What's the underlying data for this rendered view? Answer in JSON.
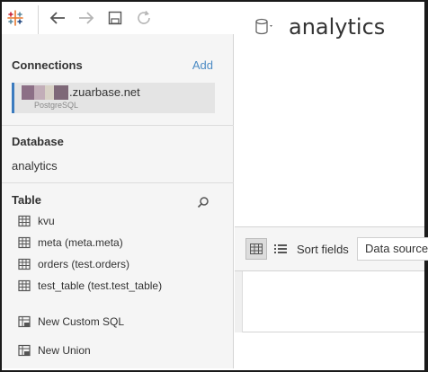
{
  "toolbar": {
    "logo": "tableau-logo-icon",
    "back": "back-arrow-icon",
    "forward": "forward-arrow-icon",
    "save": "save-icon",
    "refresh": "refresh-icon"
  },
  "connections": {
    "title": "Connections",
    "add_label": "Add",
    "items": [
      {
        "host": ".zuarbase.net",
        "type": "PostgreSQL"
      }
    ]
  },
  "database": {
    "title": "Database",
    "value": "analytics"
  },
  "table": {
    "title": "Table",
    "items": [
      {
        "label": "kvu"
      },
      {
        "label": "meta (meta.meta)"
      },
      {
        "label": "orders (test.orders)"
      },
      {
        "label": "test_table (test.test_table)"
      }
    ],
    "actions": [
      {
        "label": "New Custom SQL"
      },
      {
        "label": "New Union"
      }
    ]
  },
  "main": {
    "datasource_title": "analytics",
    "sort_label": "Sort fields",
    "sort_value": "Data source order"
  },
  "colors": {
    "accent": "#4c8bc4",
    "selection_bar": "#3b7bbf",
    "panel_bg": "#f5f5f5"
  }
}
